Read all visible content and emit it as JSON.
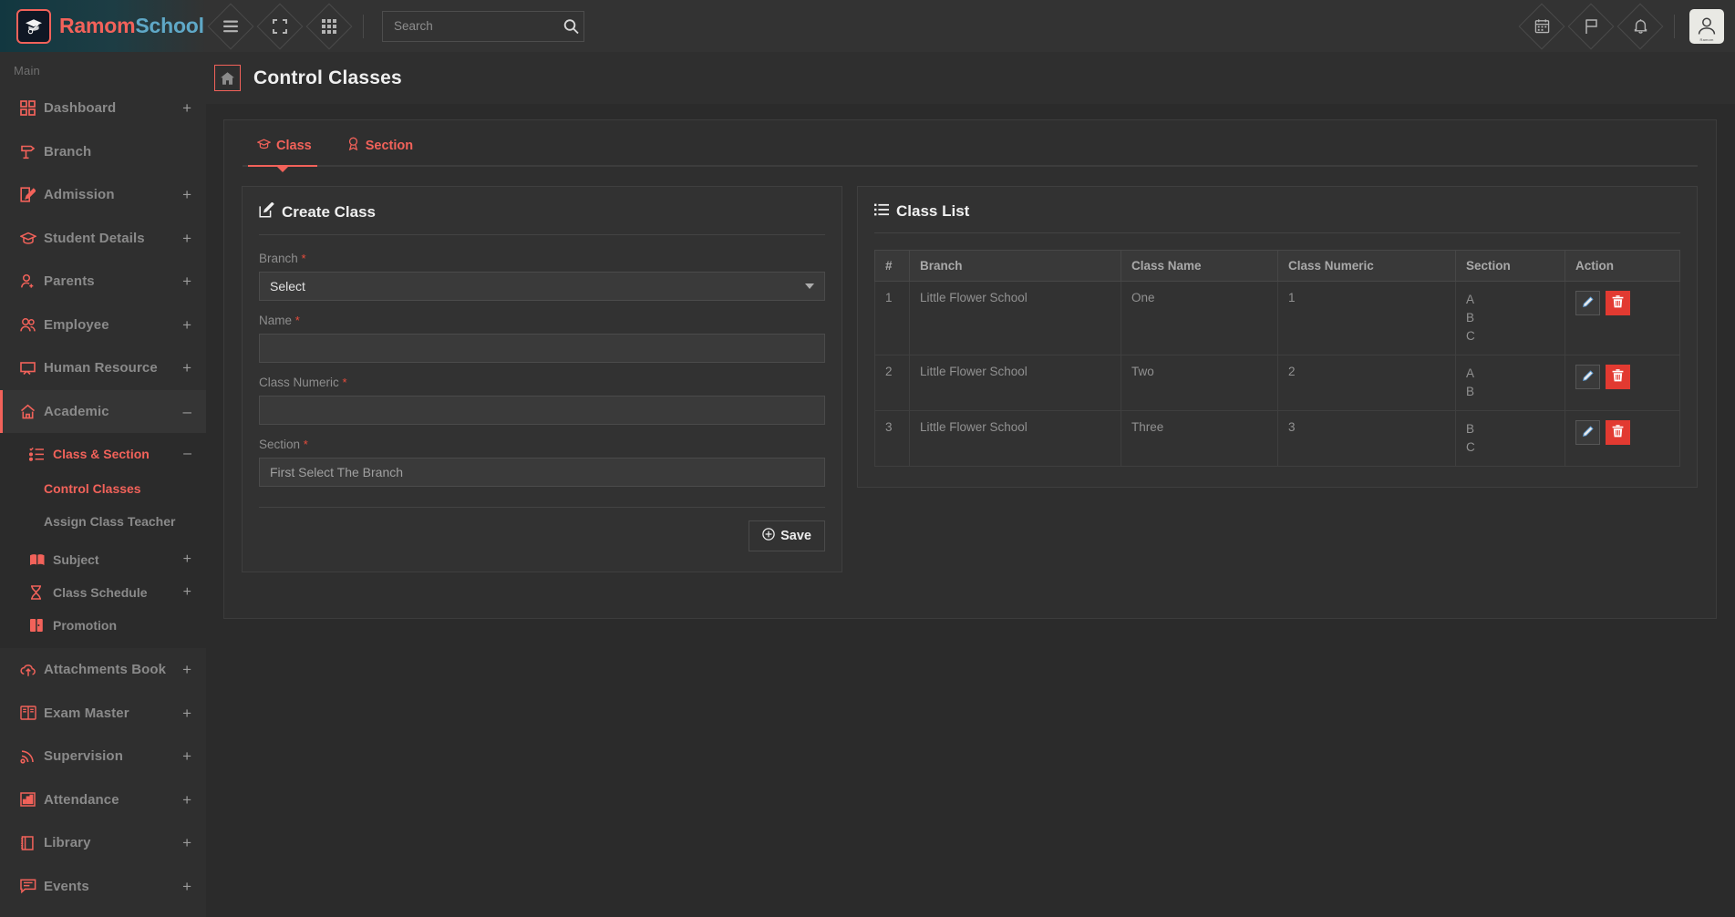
{
  "brand": {
    "name_first": "Ramom",
    "name_second": "School",
    "logo_icon": "graduation-cap-icon"
  },
  "topbar": {
    "menu_toggle_icon": "hamburger-icon",
    "fullscreen_icon": "expand-icon",
    "apps_icon": "grid-apps-icon",
    "calendar_icon": "calendar-icon",
    "flag_icon": "flag-icon",
    "bell_icon": "bell-icon",
    "avatar_icon": "user-avatar-icon",
    "avatar_name": "Ramom"
  },
  "search": {
    "placeholder": "Search",
    "value": "",
    "icon": "search-icon"
  },
  "sidebar": {
    "section_label": "Main",
    "items": [
      {
        "label": "Dashboard",
        "icon": "dashboard-grid-icon",
        "expander": "+"
      },
      {
        "label": "Branch",
        "icon": "signpost-icon",
        "expander": ""
      },
      {
        "label": "Admission",
        "icon": "edit-square-icon",
        "expander": "+"
      },
      {
        "label": "Student Details",
        "icon": "graduation-cap-icon",
        "expander": "+"
      },
      {
        "label": "Parents",
        "icon": "user-add-icon",
        "expander": "+"
      },
      {
        "label": "Employee",
        "icon": "users-icon",
        "expander": "+"
      },
      {
        "label": "Human Resource",
        "icon": "monitor-icon",
        "expander": "+"
      },
      {
        "label": "Academic",
        "icon": "home-icon",
        "expander": "–"
      }
    ],
    "academic_children": [
      {
        "label": "Class & Section",
        "icon": "checklist-icon",
        "expander": "–"
      },
      {
        "label": "Subject",
        "icon": "book-open-icon",
        "expander": "+"
      },
      {
        "label": "Class Schedule",
        "icon": "hourglass-icon",
        "expander": "+"
      },
      {
        "label": "Promotion",
        "icon": "door-icon",
        "expander": ""
      }
    ],
    "class_section_children": [
      {
        "label": "Control Classes"
      },
      {
        "label": "Assign Class Teacher"
      }
    ],
    "items_after": [
      {
        "label": "Attachments Book",
        "icon": "cloud-upload-icon",
        "expander": "+"
      },
      {
        "label": "Exam Master",
        "icon": "book-icon",
        "expander": "+"
      },
      {
        "label": "Supervision",
        "icon": "rss-icon",
        "expander": "+"
      },
      {
        "label": "Attendance",
        "icon": "bar-chart-icon",
        "expander": "+"
      },
      {
        "label": "Library",
        "icon": "library-book-icon",
        "expander": "+"
      },
      {
        "label": "Events",
        "icon": "chat-icon",
        "expander": "+"
      }
    ]
  },
  "page": {
    "title": "Control Classes",
    "home_icon": "home-icon"
  },
  "tabs": [
    {
      "label": "Class",
      "icon": "graduation-cap-icon",
      "active": true
    },
    {
      "label": "Section",
      "icon": "award-ribbon-icon",
      "active": false
    }
  ],
  "create_class": {
    "title": "Create Class",
    "title_icon": "edit-square-icon",
    "branch_label": "Branch",
    "branch_value": "Select",
    "name_label": "Name",
    "name_value": "",
    "name_placeholder": "",
    "numeric_label": "Class Numeric",
    "numeric_value": "",
    "numeric_placeholder": "",
    "section_label": "Section",
    "section_value": "First Select The Branch",
    "required_mark": "*",
    "save_label": "Save",
    "save_icon": "plus-circle-icon"
  },
  "class_list": {
    "title": "Class List",
    "title_icon": "list-icon",
    "columns": [
      "#",
      "Branch",
      "Class Name",
      "Class Numeric",
      "Section",
      "Action"
    ],
    "rows": [
      {
        "idx": "1",
        "branch": "Little Flower School",
        "class_name": "One",
        "class_numeric": "1",
        "sections": [
          "A",
          "B",
          "C"
        ]
      },
      {
        "idx": "2",
        "branch": "Little Flower School",
        "class_name": "Two",
        "class_numeric": "2",
        "sections": [
          "A",
          "B"
        ]
      },
      {
        "idx": "3",
        "branch": "Little Flower School",
        "class_name": "Three",
        "class_numeric": "3",
        "sections": [
          "B",
          "C"
        ]
      }
    ],
    "edit_icon": "pen-icon",
    "delete_icon": "trash-icon"
  },
  "colors": {
    "accent": "#f2625a",
    "danger": "#e23a31",
    "sidebar_bg": "#2f2f2f",
    "page_bg": "#2b2b2b",
    "panel_bg": "#323232"
  }
}
